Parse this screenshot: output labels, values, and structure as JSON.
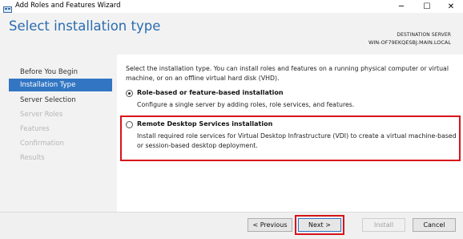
{
  "window": {
    "title": "Add Roles and Features Wizard",
    "minimize_glyph": "─",
    "maximize_glyph": "☐",
    "close_glyph": "✕"
  },
  "header": {
    "page_title": "Select installation type",
    "destination_label": "DESTINATION SERVER",
    "destination_server": "WIN-OF79EKQESBJ.MAIN.LOCAL"
  },
  "nav": {
    "items": [
      {
        "label": "Before You Begin",
        "state": "done"
      },
      {
        "label": "Installation Type",
        "state": "active"
      },
      {
        "label": "Server Selection",
        "state": "done"
      },
      {
        "label": "Server Roles",
        "state": "disabled"
      },
      {
        "label": "Features",
        "state": "disabled"
      },
      {
        "label": "Confirmation",
        "state": "disabled"
      },
      {
        "label": "Results",
        "state": "disabled"
      }
    ]
  },
  "content": {
    "intro": "Select the installation type. You can install roles and features on a running physical computer or virtual machine, or on an offline virtual hard disk (VHD).",
    "options": [
      {
        "title": "Role-based or feature-based installation",
        "description": "Configure a single server by adding roles, role services, and features.",
        "selected": true
      },
      {
        "title": "Remote Desktop Services installation",
        "description": "Install required role services for Virtual Desktop Infrastructure (VDI) to create a virtual machine-based or session-based desktop deployment.",
        "selected": false
      }
    ]
  },
  "footer": {
    "previous_label": "< Previous",
    "next_label": "Next >",
    "install_label": "Install",
    "cancel_label": "Cancel"
  },
  "colors": {
    "accent": "#3276c3",
    "title_blue": "#2b6cb0",
    "highlight_red": "#d7141a"
  }
}
